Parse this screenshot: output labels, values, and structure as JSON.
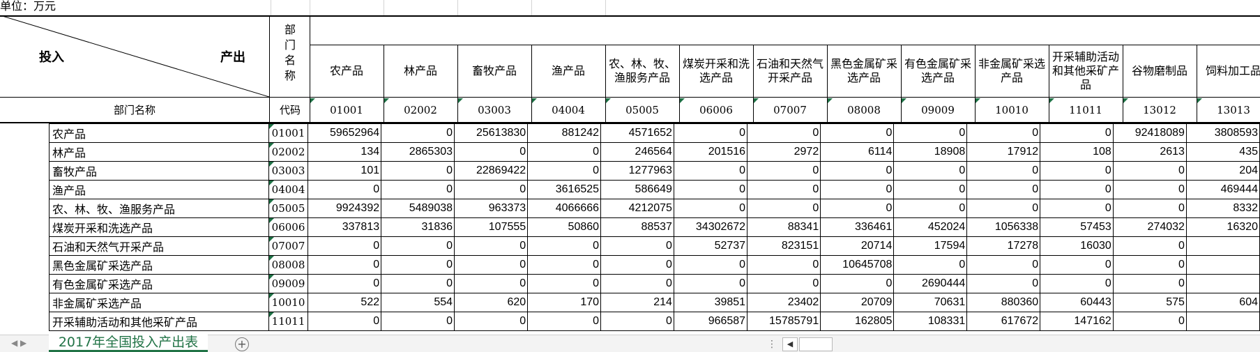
{
  "unit_label": "单位：万元",
  "corner": {
    "input_label": "投入",
    "output_label": "产出"
  },
  "dept_name_vertical": [
    "部",
    "门",
    "名",
    "称"
  ],
  "code_label": "代码",
  "row_header_label": "部门名称",
  "columns": [
    {
      "name": "农产品",
      "code": "01001"
    },
    {
      "name": "林产品",
      "code": "02002"
    },
    {
      "name": "畜牧产品",
      "code": "03003"
    },
    {
      "name": "渔产品",
      "code": "04004"
    },
    {
      "name": "农、林、牧、渔服务产品",
      "code": "05005"
    },
    {
      "name": "煤炭开采和洗选产品",
      "code": "06006"
    },
    {
      "name": "石油和天然气开采产品",
      "code": "07007"
    },
    {
      "name": "黑色金属矿采选产品",
      "code": "08008"
    },
    {
      "name": "有色金属矿采选产品",
      "code": "09009"
    },
    {
      "name": "非金属矿采选产品",
      "code": "10010"
    },
    {
      "name": "开采辅助活动和其他采矿产品",
      "code": "11011"
    },
    {
      "name": "谷物磨制品",
      "code": "13012"
    },
    {
      "name": "饲料加工品",
      "code": "13013"
    }
  ],
  "rows": [
    {
      "name": "农产品",
      "code": "01001",
      "values": [
        "59652964",
        "0",
        "25613830",
        "881242",
        "4571652",
        "0",
        "0",
        "0",
        "0",
        "0",
        "0",
        "92418089",
        "3808593"
      ]
    },
    {
      "name": "林产品",
      "code": "02002",
      "values": [
        "134",
        "2865303",
        "0",
        "0",
        "246564",
        "201516",
        "2972",
        "6114",
        "18908",
        "17912",
        "108",
        "2613",
        "435"
      ]
    },
    {
      "name": "畜牧产品",
      "code": "03003",
      "values": [
        "101",
        "0",
        "22869422",
        "0",
        "1277963",
        "0",
        "0",
        "0",
        "0",
        "0",
        "0",
        "0",
        "204"
      ]
    },
    {
      "name": "渔产品",
      "code": "04004",
      "values": [
        "0",
        "0",
        "0",
        "3616525",
        "586649",
        "0",
        "0",
        "0",
        "0",
        "0",
        "0",
        "0",
        "469444"
      ]
    },
    {
      "name": "农、林、牧、渔服务产品",
      "code": "05005",
      "values": [
        "9924392",
        "5489038",
        "963373",
        "4066666",
        "4212075",
        "0",
        "0",
        "0",
        "0",
        "0",
        "0",
        "0",
        "8332"
      ]
    },
    {
      "name": "煤炭开采和洗选产品",
      "code": "06006",
      "values": [
        "337813",
        "31836",
        "107555",
        "50860",
        "88537",
        "34302672",
        "88341",
        "336461",
        "452024",
        "1056338",
        "57453",
        "274032",
        "16320"
      ]
    },
    {
      "name": "石油和天然气开采产品",
      "code": "07007",
      "values": [
        "0",
        "0",
        "0",
        "0",
        "0",
        "52737",
        "823151",
        "20714",
        "17594",
        "17278",
        "16030",
        "0",
        ""
      ]
    },
    {
      "name": "黑色金属矿采选产品",
      "code": "08008",
      "values": [
        "0",
        "0",
        "0",
        "0",
        "0",
        "0",
        "0",
        "10645708",
        "0",
        "0",
        "0",
        "0",
        ""
      ]
    },
    {
      "name": "有色金属矿采选产品",
      "code": "09009",
      "values": [
        "0",
        "0",
        "0",
        "0",
        "0",
        "0",
        "0",
        "0",
        "2690444",
        "0",
        "0",
        "0",
        ""
      ]
    },
    {
      "name": "非金属矿采选产品",
      "code": "10010",
      "values": [
        "522",
        "554",
        "620",
        "170",
        "214",
        "39851",
        "23402",
        "20709",
        "70631",
        "880360",
        "60443",
        "575",
        "604"
      ]
    },
    {
      "name": "开采辅助活动和其他采矿产品",
      "code": "11011",
      "values": [
        "0",
        "0",
        "0",
        "0",
        "0",
        "966587",
        "15785791",
        "162805",
        "108331",
        "617672",
        "147162",
        "0",
        ""
      ]
    }
  ],
  "sheet_tab": "2017年全国投入产出表",
  "add_sheet_symbol": "+",
  "nav_prev_symbol": "◀",
  "tab_nav_symbols": "◀ ▶",
  "split_symbol": "⋮"
}
